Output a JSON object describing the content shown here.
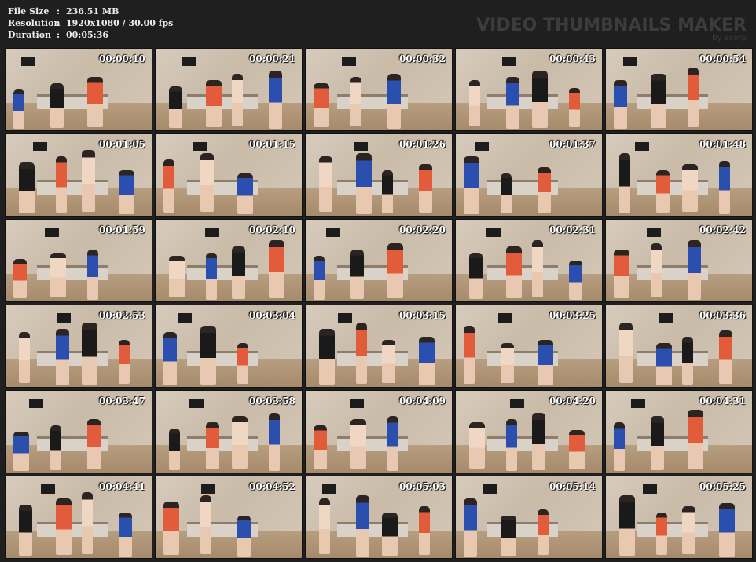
{
  "info": {
    "file_size_label": "File Size",
    "file_size_value": "236.51 MB",
    "resolution_label": "Resolution",
    "resolution_value": "1920x1080 / 30.00 fps",
    "duration_label": "Duration",
    "duration_value": "00:05:36",
    "separator": ":"
  },
  "brand": {
    "title": "VIDEO THUMBNAILS MAKER",
    "subtitle": "by Scorp"
  },
  "thumbnails": [
    "00:00:10",
    "00:00:21",
    "00:00:32",
    "00:00:43",
    "00:00:54",
    "00:01:05",
    "00:01:15",
    "00:01:26",
    "00:01:37",
    "00:01:48",
    "00:01:59",
    "00:02:10",
    "00:02:20",
    "00:02:31",
    "00:02:42",
    "00:02:53",
    "00:03:04",
    "00:03:15",
    "00:03:25",
    "00:03:36",
    "00:03:47",
    "00:03:58",
    "00:04:09",
    "00:04:20",
    "00:04:31",
    "00:04:41",
    "00:04:52",
    "00:05:03",
    "00:05:14",
    "00:05:25"
  ],
  "colors": {
    "background": "#1f1f1f",
    "text": "#ececec"
  }
}
